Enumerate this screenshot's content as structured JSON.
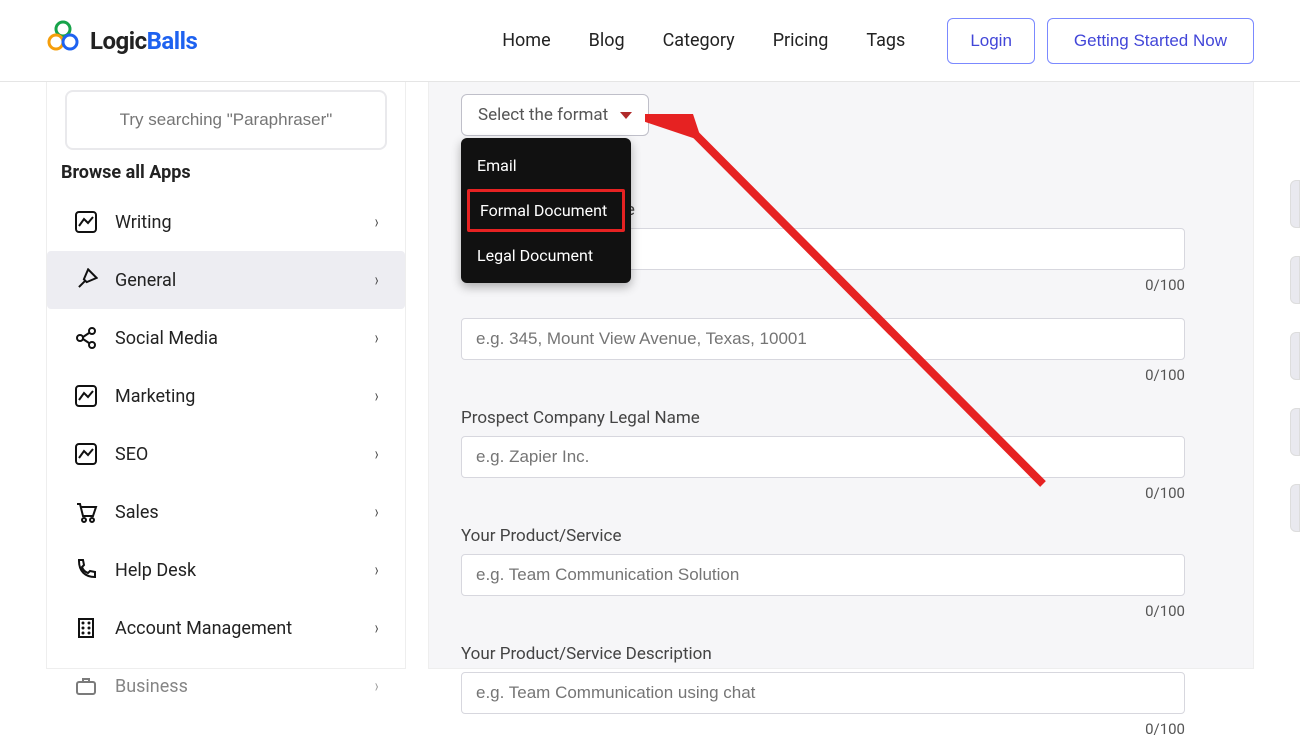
{
  "header": {
    "logo_first": "Logic",
    "logo_second": "Balls",
    "nav": [
      "Home",
      "Blog",
      "Category",
      "Pricing",
      "Tags"
    ],
    "login": "Login",
    "cta": "Getting Started Now"
  },
  "sidebar": {
    "search_placeholder": "Try searching \"Paraphraser\"",
    "browse_title": "Browse all Apps",
    "categories": [
      {
        "label": "Writing",
        "icon": "chart-icon"
      },
      {
        "label": "General",
        "icon": "pin-icon",
        "active": true
      },
      {
        "label": "Social Media",
        "icon": "share-icon"
      },
      {
        "label": "Marketing",
        "icon": "chart-icon"
      },
      {
        "label": "SEO",
        "icon": "chart-icon"
      },
      {
        "label": "Sales",
        "icon": "cart-icon"
      },
      {
        "label": "Help Desk",
        "icon": "phone-icon"
      },
      {
        "label": "Account Management",
        "icon": "building-icon"
      },
      {
        "label": "Business",
        "icon": "briefcase-icon"
      }
    ]
  },
  "main": {
    "format_select_label": "Select the format",
    "format_options": [
      "Email",
      "Formal Document",
      "Legal Document"
    ],
    "highlight_index": 1,
    "fields": [
      {
        "label_suffix": "me",
        "placeholder": "",
        "counter": "0/100"
      },
      {
        "label": "",
        "placeholder": "e.g. 345, Mount View Avenue, Texas, 10001",
        "counter": "0/100"
      },
      {
        "label": "Prospect Company Legal Name",
        "placeholder": "e.g. Zapier Inc.",
        "counter": "0/100"
      },
      {
        "label": "Your Product/Service",
        "placeholder": "e.g. Team Communication Solution",
        "counter": "0/100"
      },
      {
        "label": "Your Product/Service Description",
        "placeholder": "e.g. Team Communication using chat",
        "counter": "0/100"
      }
    ]
  }
}
